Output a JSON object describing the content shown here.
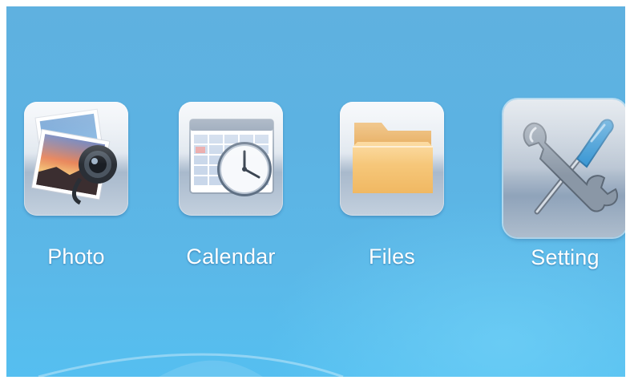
{
  "menu": {
    "items": [
      {
        "id": "photo",
        "label": "Photo",
        "icon": "photo-icon",
        "selected": false
      },
      {
        "id": "calendar",
        "label": "Calendar",
        "icon": "calendar-clock-icon",
        "selected": false
      },
      {
        "id": "files",
        "label": "Files",
        "icon": "folder-icon",
        "selected": false
      },
      {
        "id": "setting",
        "label": "Setting",
        "icon": "wrench-screwdriver-icon",
        "selected": true
      }
    ]
  },
  "colors": {
    "background_top": "#5fb1e0",
    "background_bottom": "#55bff0",
    "label_text": "#ffffff",
    "folder": "#f0b862",
    "screwdriver": "#2a8fd0"
  }
}
